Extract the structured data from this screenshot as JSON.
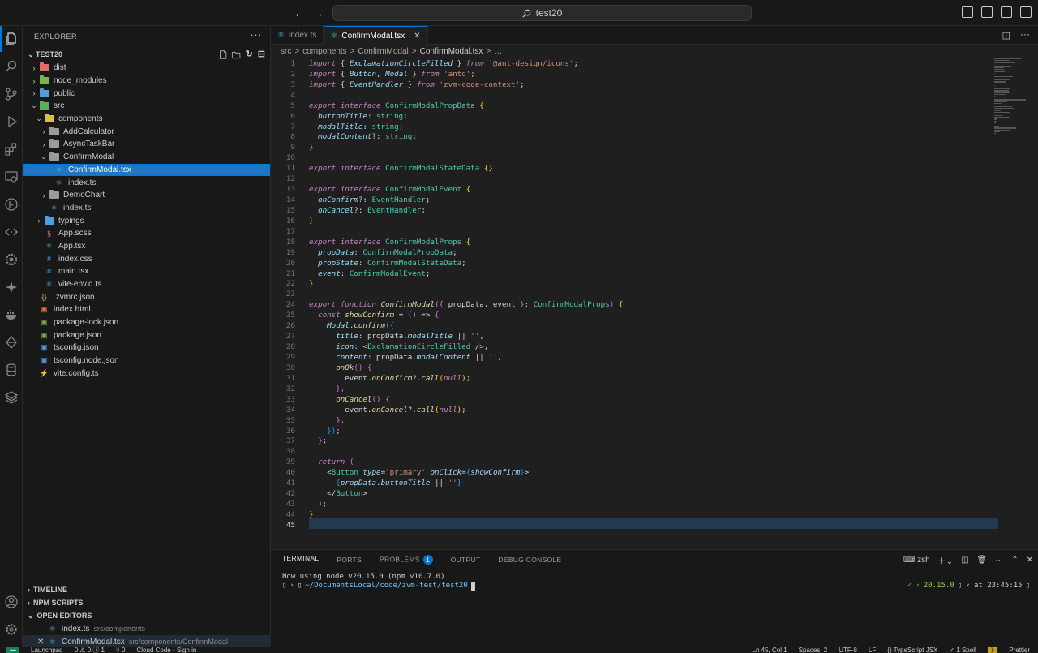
{
  "titlebar": {
    "back": "←",
    "forward": "→",
    "search": "test20"
  },
  "explorer": {
    "title": "EXPLORER",
    "project": "TEST20",
    "tree": [
      {
        "label": "dist",
        "depth": 0,
        "kind": "folder",
        "open": false,
        "color": "#e06b6b"
      },
      {
        "label": "node_modules",
        "depth": 0,
        "kind": "folder",
        "open": false,
        "color": "#7fb248"
      },
      {
        "label": "public",
        "depth": 0,
        "kind": "folder",
        "open": false,
        "color": "#4f9de0"
      },
      {
        "label": "src",
        "depth": 0,
        "kind": "folder",
        "open": true,
        "color": "#5fae5f"
      },
      {
        "label": "components",
        "depth": 1,
        "kind": "folder",
        "open": true,
        "color": "#d9c04a"
      },
      {
        "label": "AddCalculator",
        "depth": 2,
        "kind": "folder",
        "open": false,
        "color": "#9a9a9a"
      },
      {
        "label": "AsyncTaskBar",
        "depth": 2,
        "kind": "folder",
        "open": false,
        "color": "#9a9a9a"
      },
      {
        "label": "ConfirmModal",
        "depth": 2,
        "kind": "folder",
        "open": true,
        "color": "#9a9a9a"
      },
      {
        "label": "ConfirmModal.tsx",
        "depth": 3,
        "kind": "react",
        "selected": true
      },
      {
        "label": "index.ts",
        "depth": 3,
        "kind": "react"
      },
      {
        "label": "DemoChart",
        "depth": 2,
        "kind": "folder",
        "open": false,
        "color": "#9a9a9a"
      },
      {
        "label": "index.ts",
        "depth": 2,
        "kind": "react",
        "nochev": true
      },
      {
        "label": "typings",
        "depth": 1,
        "kind": "folder",
        "open": false,
        "color": "#4f9de0"
      },
      {
        "label": "App.scss",
        "depth": 1,
        "kind": "scss"
      },
      {
        "label": "App.tsx",
        "depth": 1,
        "kind": "react"
      },
      {
        "label": "index.css",
        "depth": 1,
        "kind": "css"
      },
      {
        "label": "main.tsx",
        "depth": 1,
        "kind": "react"
      },
      {
        "label": "vite-env.d.ts",
        "depth": 1,
        "kind": "ts"
      },
      {
        "label": ".zvmrc.json",
        "depth": 0,
        "kind": "json"
      },
      {
        "label": "index.html",
        "depth": 0,
        "kind": "html"
      },
      {
        "label": "package-lock.json",
        "depth": 0,
        "kind": "npm"
      },
      {
        "label": "package.json",
        "depth": 0,
        "kind": "npm"
      },
      {
        "label": "tsconfig.json",
        "depth": 0,
        "kind": "tsconfig"
      },
      {
        "label": "tsconfig.node.json",
        "depth": 0,
        "kind": "tsconfig"
      },
      {
        "label": "vite.config.ts",
        "depth": 0,
        "kind": "vite"
      }
    ],
    "sections": {
      "timeline": "TIMELINE",
      "npm": "NPM SCRIPTS",
      "open_editors": "OPEN EDITORS"
    },
    "open_editors": [
      {
        "name": "index.ts",
        "path": "src/components"
      },
      {
        "name": "ConfirmModal.tsx",
        "path": "src/components/ConfirmModal"
      }
    ]
  },
  "editor": {
    "tabs": [
      {
        "label": "index.ts"
      },
      {
        "label": "ConfirmModal.tsx",
        "active": true
      }
    ],
    "breadcrumb": [
      "src",
      ">",
      "components",
      ">",
      "ConfirmModal",
      ">",
      "ConfirmModal.tsx",
      ">",
      "…"
    ],
    "lines": [
      [
        [
          "kw",
          "import"
        ],
        [
          "p",
          " { "
        ],
        [
          "v",
          "ExclamationCircleFilled"
        ],
        [
          "p",
          " } "
        ],
        [
          "kw",
          "from"
        ],
        [
          "p",
          " "
        ],
        [
          "s",
          "'@ant-design/icons'"
        ],
        [
          "p",
          ";"
        ]
      ],
      [
        [
          "kw",
          "import"
        ],
        [
          "p",
          " { "
        ],
        [
          "v",
          "Button"
        ],
        [
          "p",
          ", "
        ],
        [
          "v",
          "Modal"
        ],
        [
          "p",
          " } "
        ],
        [
          "kw",
          "from"
        ],
        [
          "p",
          " "
        ],
        [
          "s",
          "'antd'"
        ],
        [
          "p",
          ";"
        ]
      ],
      [
        [
          "kw",
          "import"
        ],
        [
          "p",
          " { "
        ],
        [
          "v",
          "EventHandler"
        ],
        [
          "p",
          " } "
        ],
        [
          "kw",
          "from"
        ],
        [
          "p",
          " "
        ],
        [
          "s",
          "'zvm-code-context'"
        ],
        [
          "p",
          ";"
        ]
      ],
      [],
      [
        [
          "kw",
          "export"
        ],
        [
          "p",
          " "
        ],
        [
          "kw",
          "interface"
        ],
        [
          "p",
          " "
        ],
        [
          "t",
          "ConfirmModalPropData"
        ],
        [
          "p",
          " "
        ],
        [
          "b",
          "{"
        ]
      ],
      [
        [
          "p",
          "  "
        ],
        [
          "v",
          "buttonTitle"
        ],
        [
          "p",
          ": "
        ],
        [
          "t",
          "string"
        ],
        [
          "p",
          ";"
        ]
      ],
      [
        [
          "p",
          "  "
        ],
        [
          "v",
          "modalTitle"
        ],
        [
          "p",
          ": "
        ],
        [
          "t",
          "string"
        ],
        [
          "p",
          ";"
        ]
      ],
      [
        [
          "p",
          "  "
        ],
        [
          "v",
          "modalContent"
        ],
        [
          "p",
          "?: "
        ],
        [
          "t",
          "string"
        ],
        [
          "p",
          ";"
        ]
      ],
      [
        [
          "b",
          "}"
        ]
      ],
      [],
      [
        [
          "kw",
          "export"
        ],
        [
          "p",
          " "
        ],
        [
          "kw",
          "interface"
        ],
        [
          "p",
          " "
        ],
        [
          "t",
          "ConfirmModalStateData"
        ],
        [
          "p",
          " "
        ],
        [
          "b",
          "{}"
        ]
      ],
      [],
      [
        [
          "kw",
          "export"
        ],
        [
          "p",
          " "
        ],
        [
          "kw",
          "interface"
        ],
        [
          "p",
          " "
        ],
        [
          "t",
          "ConfirmModalEvent"
        ],
        [
          "p",
          " "
        ],
        [
          "b",
          "{"
        ]
      ],
      [
        [
          "p",
          "  "
        ],
        [
          "v",
          "onConfirm"
        ],
        [
          "p",
          "?: "
        ],
        [
          "t",
          "EventHandler"
        ],
        [
          "p",
          ";"
        ]
      ],
      [
        [
          "p",
          "  "
        ],
        [
          "v",
          "onCancel"
        ],
        [
          "p",
          "?: "
        ],
        [
          "t",
          "EventHandler"
        ],
        [
          "p",
          ";"
        ]
      ],
      [
        [
          "b",
          "}"
        ]
      ],
      [],
      [
        [
          "kw",
          "export"
        ],
        [
          "p",
          " "
        ],
        [
          "kw",
          "interface"
        ],
        [
          "p",
          " "
        ],
        [
          "t",
          "ConfirmModalProps"
        ],
        [
          "p",
          " "
        ],
        [
          "b",
          "{"
        ]
      ],
      [
        [
          "p",
          "  "
        ],
        [
          "v",
          "propData"
        ],
        [
          "p",
          ": "
        ],
        [
          "t",
          "ConfirmModalPropData"
        ],
        [
          "p",
          ";"
        ]
      ],
      [
        [
          "p",
          "  "
        ],
        [
          "v",
          "propState"
        ],
        [
          "p",
          ": "
        ],
        [
          "t",
          "ConfirmModalStateData"
        ],
        [
          "p",
          ";"
        ]
      ],
      [
        [
          "p",
          "  "
        ],
        [
          "v",
          "event"
        ],
        [
          "p",
          ": "
        ],
        [
          "t",
          "ConfirmModalEvent"
        ],
        [
          "p",
          ";"
        ]
      ],
      [
        [
          "b",
          "}"
        ]
      ],
      [],
      [
        [
          "kw",
          "export"
        ],
        [
          "p",
          " "
        ],
        [
          "kw",
          "function"
        ],
        [
          "p",
          " "
        ],
        [
          "f",
          "ConfirmModal"
        ],
        [
          "b2",
          "({"
        ],
        [
          "p",
          " propData, event "
        ],
        [
          "b2",
          "}"
        ],
        [
          "p",
          ": "
        ],
        [
          "t",
          "ConfirmModalProps"
        ],
        [
          "b2",
          ")"
        ],
        [
          "p",
          " "
        ],
        [
          "b",
          "{"
        ]
      ],
      [
        [
          "p",
          "  "
        ],
        [
          "kw",
          "const"
        ],
        [
          "p",
          " "
        ],
        [
          "f",
          "showConfirm"
        ],
        [
          "p",
          " = "
        ],
        [
          "b2",
          "()"
        ],
        [
          "p",
          " => "
        ],
        [
          "b2",
          "{"
        ]
      ],
      [
        [
          "p",
          "    "
        ],
        [
          "v",
          "Modal"
        ],
        [
          "p",
          "."
        ],
        [
          "f",
          "confirm"
        ],
        [
          "b3",
          "({"
        ]
      ],
      [
        [
          "p",
          "      "
        ],
        [
          "v",
          "title"
        ],
        [
          "p",
          ": propData."
        ],
        [
          "v",
          "modalTitle"
        ],
        [
          "p",
          " || "
        ],
        [
          "s",
          "''"
        ],
        [
          "p",
          ","
        ]
      ],
      [
        [
          "p",
          "      "
        ],
        [
          "v",
          "icon"
        ],
        [
          "p",
          ": <"
        ],
        [
          "t",
          "ExclamationCircleFilled"
        ],
        [
          "p",
          " />,"
        ]
      ],
      [
        [
          "p",
          "      "
        ],
        [
          "v",
          "content"
        ],
        [
          "p",
          ": propData."
        ],
        [
          "v",
          "modalContent"
        ],
        [
          "p",
          " || "
        ],
        [
          "s",
          "''"
        ],
        [
          "p",
          ","
        ]
      ],
      [
        [
          "p",
          "      "
        ],
        [
          "f",
          "onOk"
        ],
        [
          "b2",
          "()"
        ],
        [
          "p",
          " "
        ],
        [
          "b2",
          "{"
        ]
      ],
      [
        [
          "p",
          "        event."
        ],
        [
          "f",
          "onConfirm"
        ],
        [
          "p",
          "?."
        ],
        [
          "f",
          "call"
        ],
        [
          "b",
          "("
        ],
        [
          "kw",
          "null"
        ],
        [
          "b",
          ")"
        ],
        [
          "p",
          ";"
        ]
      ],
      [
        [
          "p",
          "      "
        ],
        [
          "b2",
          "},"
        ]
      ],
      [
        [
          "p",
          "      "
        ],
        [
          "f",
          "onCancel"
        ],
        [
          "b2",
          "()"
        ],
        [
          "p",
          " "
        ],
        [
          "b2",
          "{"
        ]
      ],
      [
        [
          "p",
          "        event."
        ],
        [
          "f",
          "onCancel"
        ],
        [
          "p",
          "?."
        ],
        [
          "f",
          "call"
        ],
        [
          "b",
          "("
        ],
        [
          "kw",
          "null"
        ],
        [
          "b",
          ")"
        ],
        [
          "p",
          ";"
        ]
      ],
      [
        [
          "p",
          "      "
        ],
        [
          "b2",
          "},"
        ]
      ],
      [
        [
          "p",
          "    "
        ],
        [
          "b3",
          "})"
        ],
        [
          "p",
          ";"
        ]
      ],
      [
        [
          "p",
          "  "
        ],
        [
          "b2",
          "}"
        ],
        [
          "p",
          ";"
        ]
      ],
      [],
      [
        [
          "p",
          "  "
        ],
        [
          "kw",
          "return"
        ],
        [
          "p",
          " "
        ],
        [
          "b2",
          "("
        ]
      ],
      [
        [
          "p",
          "    <"
        ],
        [
          "t",
          "Button"
        ],
        [
          "p",
          " "
        ],
        [
          "v",
          "type"
        ],
        [
          "p",
          "="
        ],
        [
          "s",
          "'primary'"
        ],
        [
          "p",
          " "
        ],
        [
          "v",
          "onClick"
        ],
        [
          "p",
          "="
        ],
        [
          "b3",
          "{"
        ],
        [
          "v",
          "showConfirm"
        ],
        [
          "b3",
          "}"
        ],
        [
          "p",
          ">"
        ]
      ],
      [
        [
          "p",
          "      "
        ],
        [
          "b3",
          "{"
        ],
        [
          "v",
          "propData"
        ],
        [
          "p",
          "."
        ],
        [
          "v",
          "buttonTitle"
        ],
        [
          "p",
          " || "
        ],
        [
          "s",
          "''"
        ],
        [
          "b3",
          "}"
        ]
      ],
      [
        [
          "p",
          "    </"
        ],
        [
          "t",
          "Button"
        ],
        [
          "p",
          ">"
        ]
      ],
      [
        [
          "p",
          "  "
        ],
        [
          "b2",
          ")"
        ],
        [
          "p",
          ";"
        ]
      ],
      [
        [
          "b",
          "}"
        ]
      ],
      []
    ]
  },
  "panel": {
    "tabs": [
      "TERMINAL",
      "PORTS",
      "PROBLEMS",
      "OUTPUT",
      "DEBUG CONSOLE"
    ],
    "problems_count": "1",
    "shell": "zsh",
    "output_line": "Now using node v20.15.0 (npm v10.7.0)",
    "prompt_path": "~/DocumentsLocal/code/zvm-test/test20",
    "node_version": "20.15.0",
    "time": "at 23:45:15"
  },
  "status": {
    "left": [
      "Launchpad",
      "0 ⚠ 0 ⓘ 1",
      "⑂ 0",
      "Cloud Code - Sign in"
    ],
    "right": [
      "Ln 45, Col 1",
      "Spaces: 2",
      "UTF-8",
      "LF",
      "{} TypeScript JSX",
      "✓ 1 Spell",
      "Prettier"
    ]
  },
  "colors": {
    "accent": "#0078d4",
    "kw": "#c586c0",
    "string": "#ce9178",
    "type": "#4ec9b0",
    "fn": "#dcdcaa",
    "var": "#9cdcfe"
  }
}
